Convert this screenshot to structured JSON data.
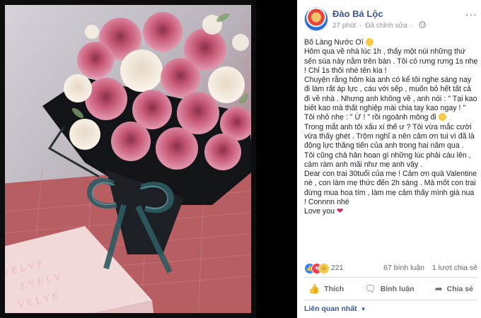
{
  "post": {
    "author": "Đào Bá Lộc",
    "time": "27 phút",
    "edited": "Đã chỉnh sửa",
    "more": "···",
    "lines": [
      "Bố Làng Nước Ơi",
      "Hôm qua về nhà lúc 1h , thấy một nùi những thứ sến súa này nằm trên bàn . Tôi có rưng rưng 1s nhẹ ! Chỉ 1s thôi nhé tên kia !",
      "Chuyện rằng hôm kia anh có kể tôi nghe sáng nay đi làm rất áp lực , cáu với sếp , muốn bỏ hết tất cả đi về nhà . Nhưng anh không về , anh nói : \" Tại kao biết kao mà thất nghiệp mài chia tay kao ngay ! \"",
      "Tôi nhỏ nhẹ : \" Ừ ! \" rồi ngoảnh mông đi",
      "Trong mắt anh tôi xấu xí thế ư ? Tôi vừa mắc cười vừa thấy ghét . Trộm nghĩ a nên cảm ơn tui vì đã là động lực thăng tiến của anh trong hai năm qua .",
      "Tôi cũng chả hân hoan gì những lúc phải cáu lên , càm ràm anh mãi như mẹ anh vậy .",
      "Dear con trai 30tuổi của mẹ ! Cảm ơn quà Valentine nè , con làm mẹ thức đến 2h sáng . Mà mốt con trai đừng mua hoa tím , làm mẹ cảm thấy mình già nua ! Connnn nhé",
      "Love you"
    ]
  },
  "reactions": {
    "count": "221",
    "comments": "67 bình luận",
    "shares": "1 lượt chia sẻ"
  },
  "actions": {
    "like": "Thích",
    "comment": "Bình luận",
    "share": "Chia sẻ"
  },
  "footer": {
    "related": "Liên quan nhất"
  }
}
